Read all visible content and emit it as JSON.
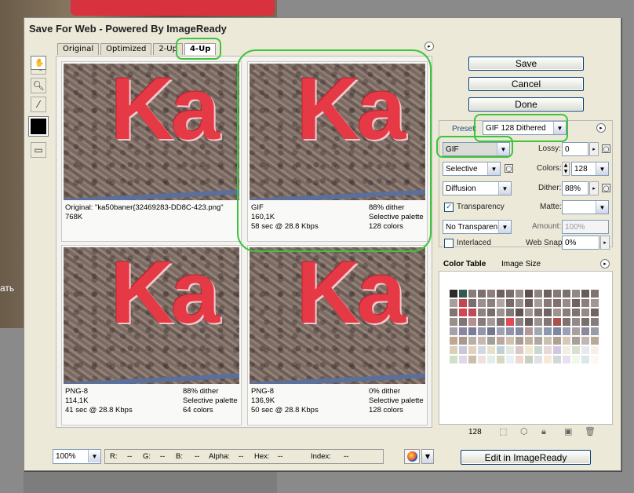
{
  "background": {
    "visible_text": "ать"
  },
  "window": {
    "title": "Save For Web - Powered By ImageReady"
  },
  "tabs": [
    {
      "label": "Original",
      "active": false
    },
    {
      "label": "Optimized",
      "active": false
    },
    {
      "label": "2-Up",
      "active": false
    },
    {
      "label": "4-Up",
      "active": true
    }
  ],
  "tools": [
    "hand-tool",
    "slice-select-tool",
    "zoom-tool",
    "eyedropper-tool"
  ],
  "panes": [
    {
      "image_text": "Ka",
      "line1": "Original: \"ka50baner{32469283-DD8C-423.png\"",
      "line2": "768K",
      "line3": "",
      "r1": "",
      "r2": "",
      "r3": ""
    },
    {
      "image_text": "Ka",
      "line1": "GIF",
      "line2": "160,1K",
      "line3": "58 sec @ 28.8 Kbps",
      "r1": "88% dither",
      "r2": "Selective palette",
      "r3": "128 colors"
    },
    {
      "image_text": "Ka",
      "line1": "PNG-8",
      "line2": "114,1K",
      "line3": "41 sec @ 28.8 Kbps",
      "r1": "88% dither",
      "r2": "Selective palette",
      "r3": "64 colors"
    },
    {
      "image_text": "Ka",
      "line1": "PNG-8",
      "line2": "136,9K",
      "line3": "50 sec @ 28.8 Kbps",
      "r1": "0% dither",
      "r2": "Selective palette",
      "r3": "128 colors"
    }
  ],
  "buttons": {
    "save": "Save",
    "cancel": "Cancel",
    "done": "Done",
    "edit": "Edit in ImageReady"
  },
  "settings": {
    "preset_label": "Preset:",
    "preset_value": "GIF 128 Dithered",
    "format": "GIF",
    "reduction": "Selective",
    "dither_algo": "Diffusion",
    "transparency_label": "Transparency",
    "transparency_checked": true,
    "transparency_dither": "No Transparen...",
    "interlaced_label": "Interlaced",
    "interlaced_checked": false,
    "lossy_label": "Lossy:",
    "lossy_value": "0",
    "colors_label": "Colors:",
    "colors_value": "128",
    "dither_label": "Dither:",
    "dither_value": "88%",
    "matte_label": "Matte:",
    "amount_label": "Amount:",
    "amount_value": "100%",
    "websnap_label": "Web Snap:",
    "websnap_value": "0%"
  },
  "color_table": {
    "tab_label": "Color Table",
    "image_size_label": "Image Size",
    "count": "128",
    "colors": [
      "#2b2b2b",
      "#355a52",
      "#8a7a7a",
      "#7e6e6e",
      "#8d7f7c",
      "#6e6060",
      "#7a6d6a",
      "#9a8c88",
      "#5e5050",
      "#8e8282",
      "#6d6060",
      "#857877",
      "#7c6f6f",
      "#948886",
      "#675a5a",
      "#807373",
      "#a9a09e",
      "#c24850",
      "#7b6f6d",
      "#9c8f8d",
      "#8c807e",
      "#b1a6a4",
      "#786b6a",
      "#9a8e8b",
      "#6b5f5e",
      "#a69b99",
      "#867a78",
      "#7d706f",
      "#988b89",
      "#6f6261",
      "#8b7f7d",
      "#a29694",
      "#807372",
      "#d24652",
      "#b94c55",
      "#8f8382",
      "#7a6d6c",
      "#9e9290",
      "#857978",
      "#5e5352",
      "#a19694",
      "#7e7270",
      "#6f6463",
      "#9f9391",
      "#897d7b",
      "#7f7372",
      "#958987",
      "#716564",
      "#9a8e8c",
      "#817574",
      "#b38f91",
      "#887c7a",
      "#a59a98",
      "#7b6f6e",
      "#e04a55",
      "#8c807f",
      "#6a5e5d",
      "#9d9190",
      "#837776",
      "#a8514f",
      "#7e7271",
      "#948988",
      "#7a6e6d",
      "#887d7b",
      "#a6a0a8",
      "#8a86a0",
      "#7a7c98",
      "#9098a8",
      "#707890",
      "#a2a0b0",
      "#9094a8",
      "#868aa0",
      "#b09898",
      "#a0a8b0",
      "#8c98b0",
      "#7c88a0",
      "#9aa0b8",
      "#a8a0a0",
      "#8c8898",
      "#989ca8",
      "#c0a890",
      "#a89890",
      "#b8b0a8",
      "#c8b8b0",
      "#a0a098",
      "#b8a8a0",
      "#d0c0b0",
      "#a89c94",
      "#c0b0a0",
      "#b0a8a0",
      "#c8c0b0",
      "#b0a090",
      "#d8c8b8",
      "#a8a098",
      "#c0b8b0",
      "#b8a898",
      "#d8d0b8",
      "#c8c8d8",
      "#e0d0c0",
      "#d0d8e0",
      "#e8e0c8",
      "#c0d0d8",
      "#e0e8e0",
      "#d8c8c8",
      "#f0e8d0",
      "#c8d8d0",
      "#e8d8d8",
      "#d0c8e0",
      "#f0f0e0",
      "#d8e0d0",
      "#e8e8f0",
      "#f8f0e8",
      "#d0e0c8",
      "#e0d8e8",
      "#c8c0a8",
      "#f0e0e0",
      "#e0f0e8",
      "#d8d8c0",
      "#e8f0f8",
      "#f0d8d0",
      "#c8d0c0",
      "#e0e0e8",
      "#f8e8d8",
      "#d0d8d8",
      "#e8e0f0",
      "#f0f8e8",
      "#d8e8e8",
      "#fff8f0"
    ]
  },
  "statusbar": {
    "zoom": "100%",
    "r_label": "R:",
    "r_value": "--",
    "g_label": "G:",
    "g_value": "--",
    "b_label": "B:",
    "b_value": "--",
    "alpha_label": "Alpha:",
    "alpha_value": "--",
    "hex_label": "Hex:",
    "hex_value": "--",
    "index_label": "Index:",
    "index_value": "--"
  },
  "highlight_color": "#3dc43d"
}
